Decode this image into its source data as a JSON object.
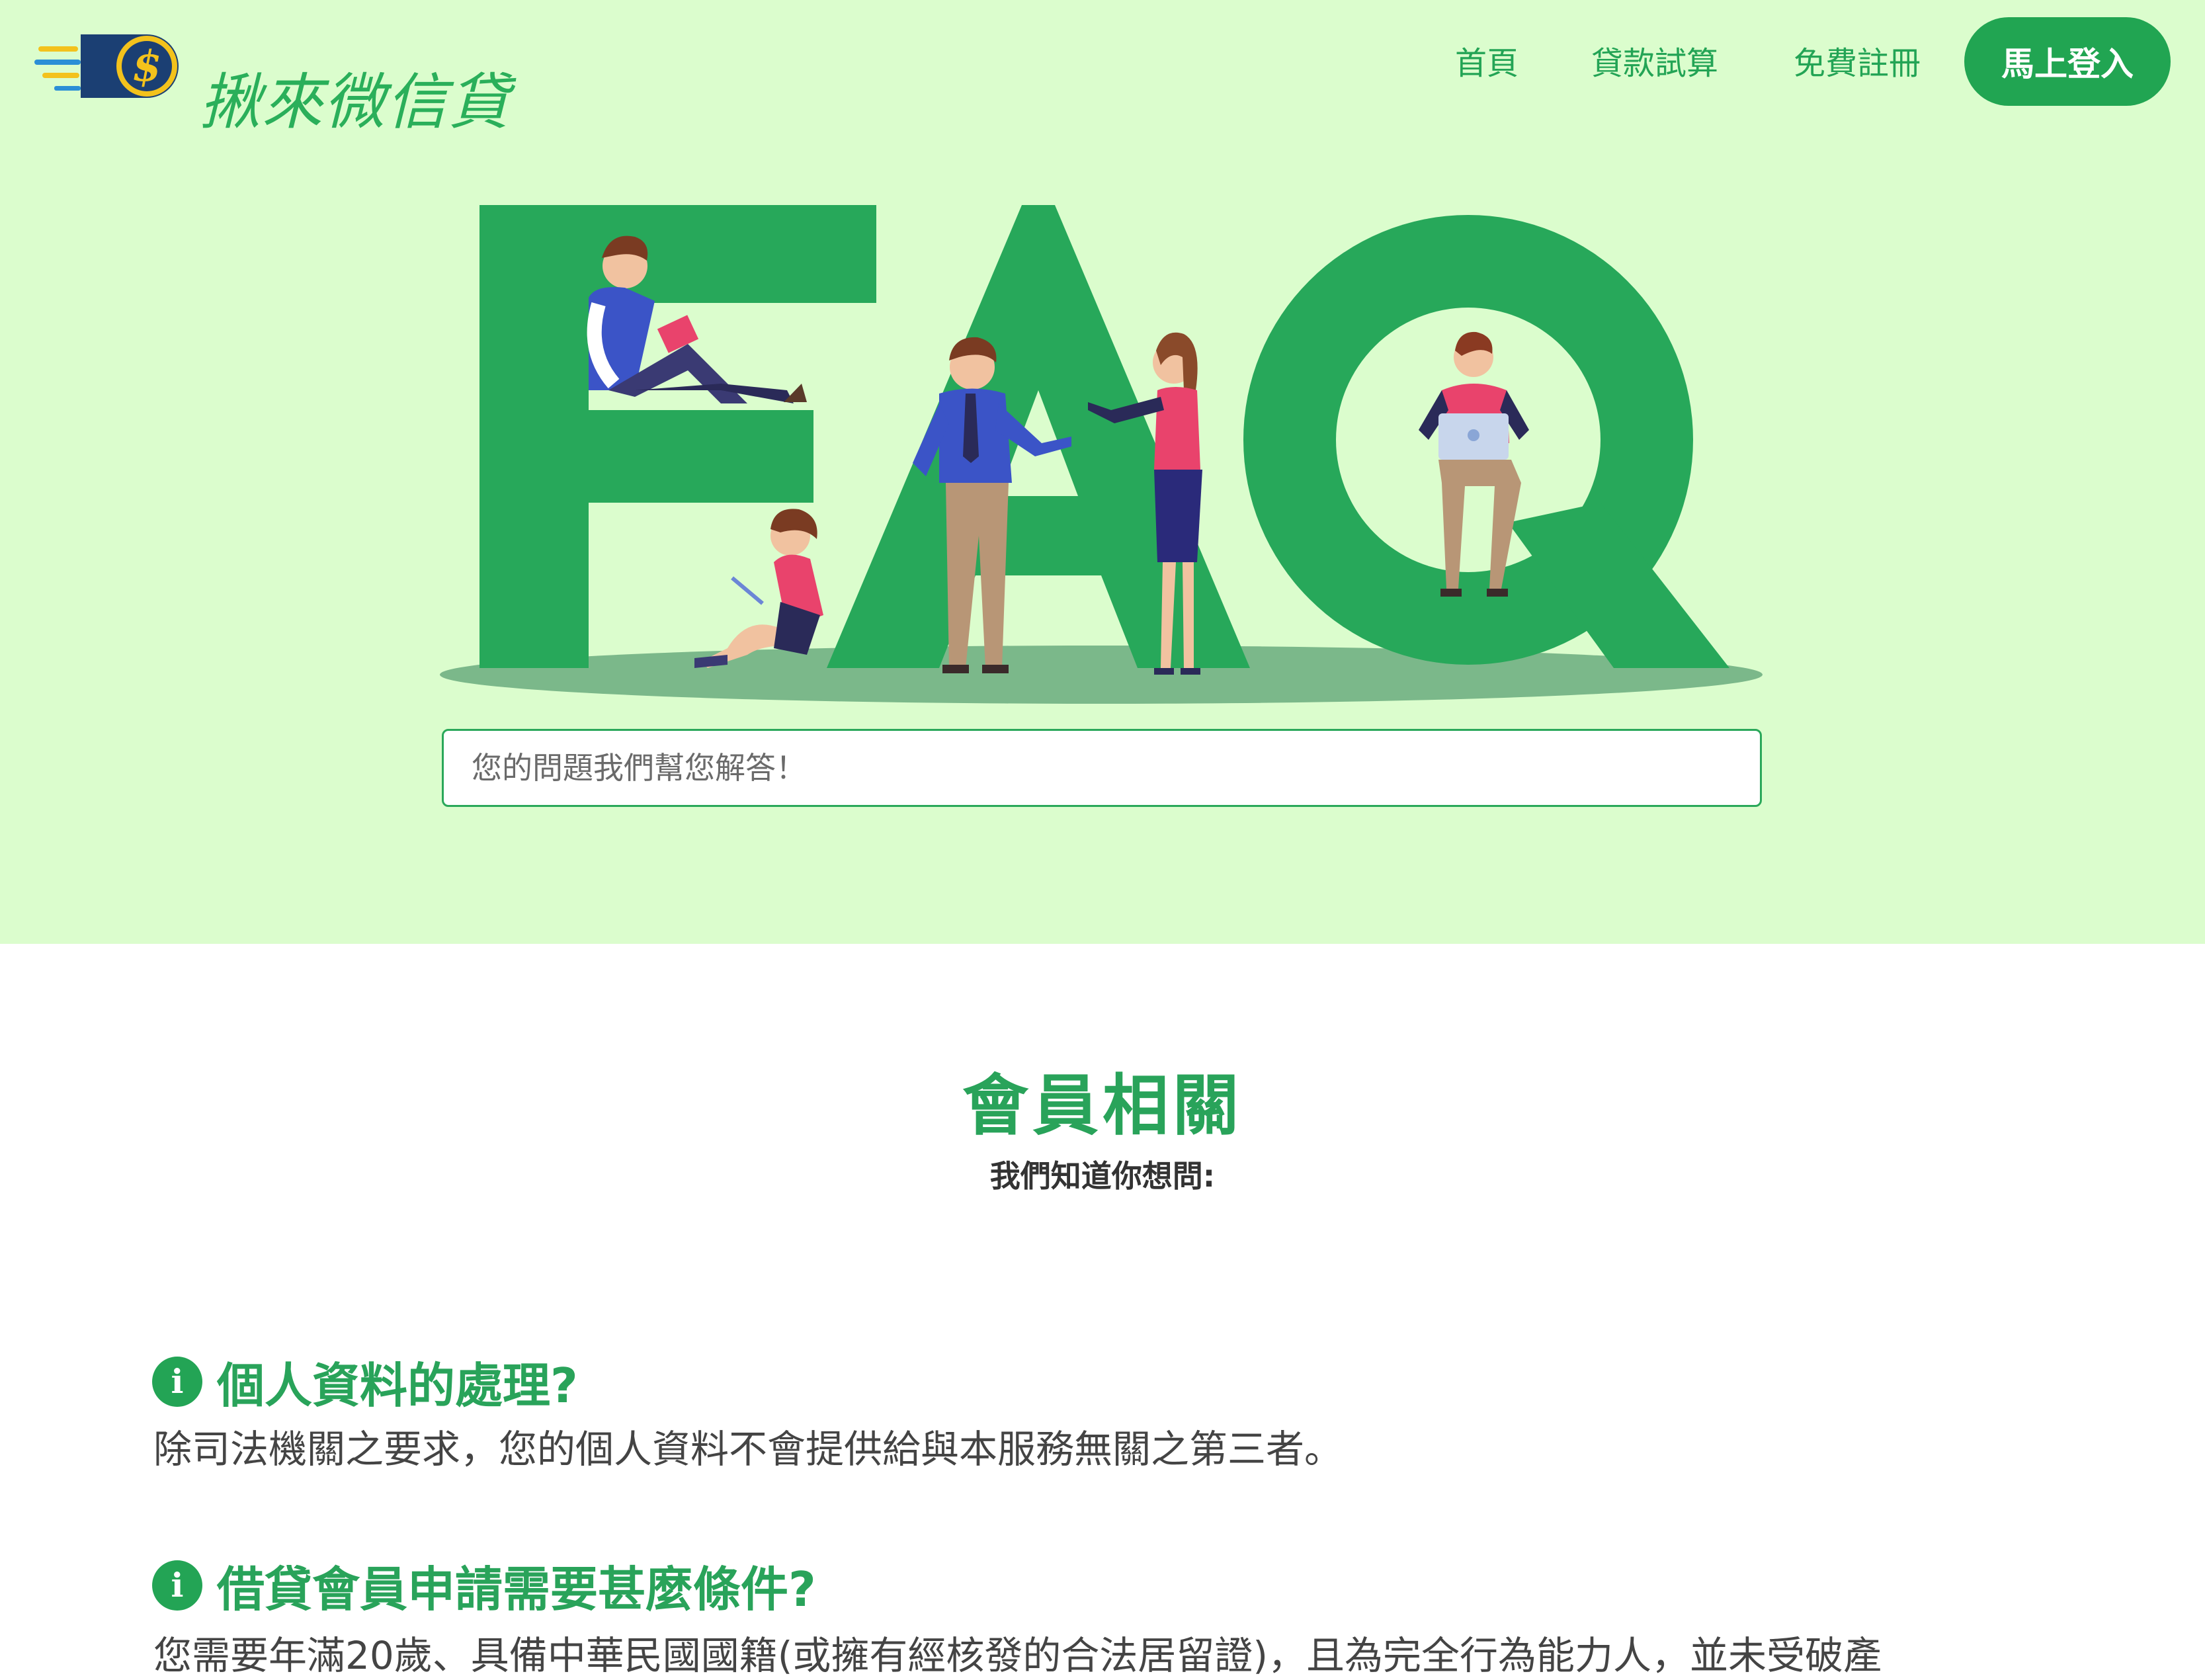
{
  "brand": {
    "name": "揪來微信貸",
    "logo_symbol": "$",
    "accent": "#23a455"
  },
  "nav": {
    "home": "首頁",
    "calc": "貸款試算",
    "register": "免費註冊",
    "login": "馬上登入"
  },
  "hero": {
    "illustration_text": "FAQ",
    "search_placeholder": "您的問題我們幫您解答！"
  },
  "section": {
    "title": "會員相關",
    "subtitle": "我們知道你想問:"
  },
  "faqs": [
    {
      "icon": "info-icon",
      "question": "個人資料的處理?",
      "answer": "除司法機關之要求，您的個人資料不會提供給與本服務無關之第三者。"
    },
    {
      "icon": "info-icon",
      "question": "借貸會員申請需要甚麼條件?",
      "answer": "您需要年滿20歲、具備中華民國國籍(或擁有經核發的合法居留證)，且為完全行為能力人，並未受破產"
    }
  ]
}
